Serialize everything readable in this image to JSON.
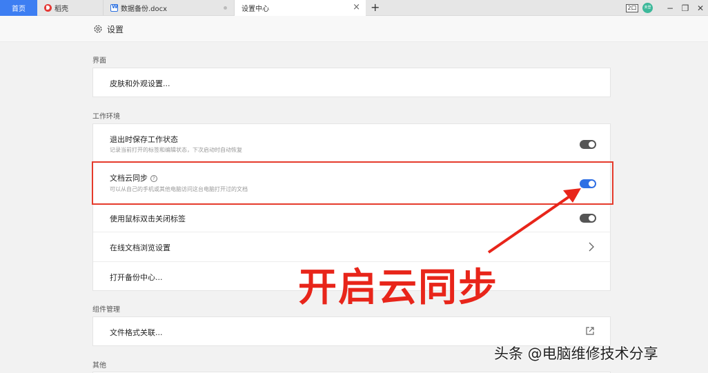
{
  "tabs": {
    "home": "首页",
    "daoke": "稻壳",
    "doc": "数据备份.docx",
    "settings": "设置中心"
  },
  "window": {
    "badge": "2口",
    "avatar": "未登",
    "minimize": "−",
    "restore": "❐",
    "close": "✕"
  },
  "header": {
    "title": "设置"
  },
  "sections": {
    "interface": {
      "label": "界面",
      "rows": [
        {
          "title": "皮肤和外观设置..."
        }
      ]
    },
    "workspace": {
      "label": "工作环境",
      "rows": [
        {
          "title": "退出时保存工作状态",
          "desc": "记录当前打开的标签和编辑状态，下次启动时自动恢复",
          "control": "toggle",
          "state": "off"
        },
        {
          "title": "文档云同步",
          "desc": "可以从自己的手机或其他电脑访问这台电脑打开过的文档",
          "control": "toggle",
          "state": "on"
        },
        {
          "title": "使用鼠标双击关闭标签",
          "control": "toggle",
          "state": "off"
        },
        {
          "title": "在线文档浏览设置",
          "control": "chevron"
        },
        {
          "title": "打开备份中心..."
        }
      ]
    },
    "components": {
      "label": "组件管理",
      "rows": [
        {
          "title": "文件格式关联...",
          "control": "external-link"
        }
      ]
    },
    "other": {
      "label": "其他"
    }
  },
  "annotation": {
    "text": "开启云同步",
    "color": "#e8251a"
  },
  "watermark": {
    "text": "头条 @电脑维修技术分享"
  },
  "colors": {
    "accent": "#3d7ef2",
    "toggle_on": "#2f6fe4",
    "toggle_off": "#555555",
    "highlight": "#e53a2b"
  }
}
